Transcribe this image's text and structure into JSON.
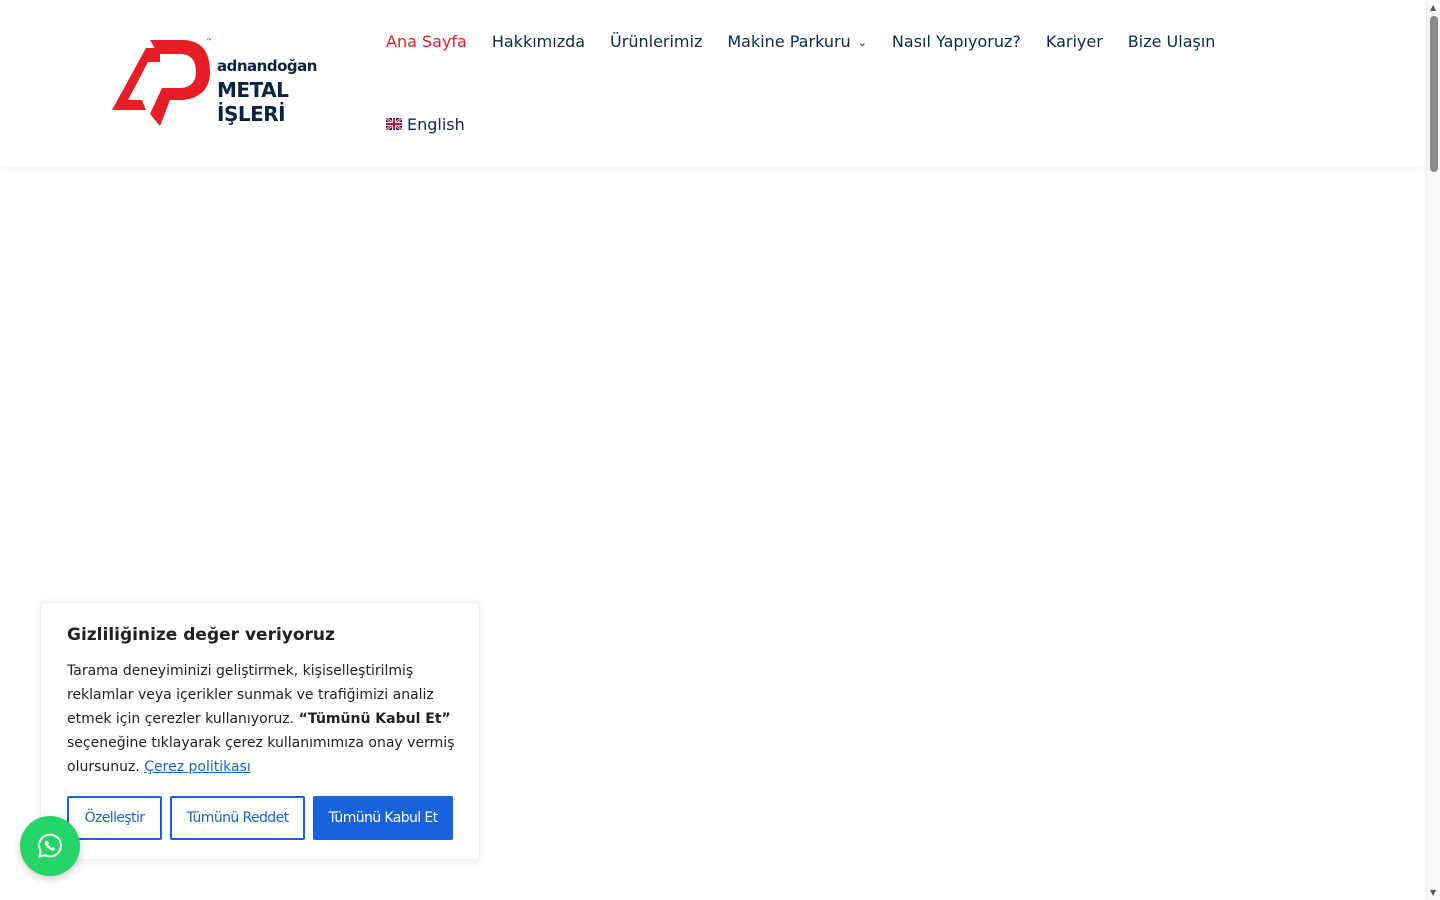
{
  "brand": {
    "logo_line1": "adnandoğan",
    "logo_line2": "METAL İŞLERİ",
    "logo_tm": "™",
    "accent_color": "#e31e24",
    "navy_color": "#0b2342"
  },
  "nav": {
    "items": [
      {
        "label": "Ana Sayfa",
        "active": true
      },
      {
        "label": "Hakkımızda"
      },
      {
        "label": "Ürünlerimiz"
      },
      {
        "label": "Makine Parkuru",
        "has_dropdown": true,
        "icon": "chevron-down-icon"
      },
      {
        "label": "Nasıl Yapıyoruz?"
      },
      {
        "label": "Kariyer"
      },
      {
        "label": "Bize Ulaşın"
      }
    ],
    "language": {
      "label": "English",
      "icon": "uk-flag-icon"
    }
  },
  "cookie": {
    "title": "Gizliliğinize değer veriyoruz",
    "text_before": "Tarama deneyiminizi geliştirmek, kişiselleştirilmiş reklamlar veya içerikler sunmak ve trafiğimizi analiz etmek için çerezler kullanıyoruz.",
    "text_bold": "“Tümünü Kabul Et”",
    "text_after": "seçeneğine tıklayarak çerez kullanımımıza onay vermiş olursunuz.",
    "policy_link": "Çerez politikası",
    "buttons": {
      "customize": "Özelleştir",
      "reject": "Tümünü Reddet",
      "accept": "Tümünü Kabul Et"
    },
    "button_color": "#1863dc"
  },
  "whatsapp": {
    "icon": "whatsapp-icon",
    "color": "#25d366"
  }
}
